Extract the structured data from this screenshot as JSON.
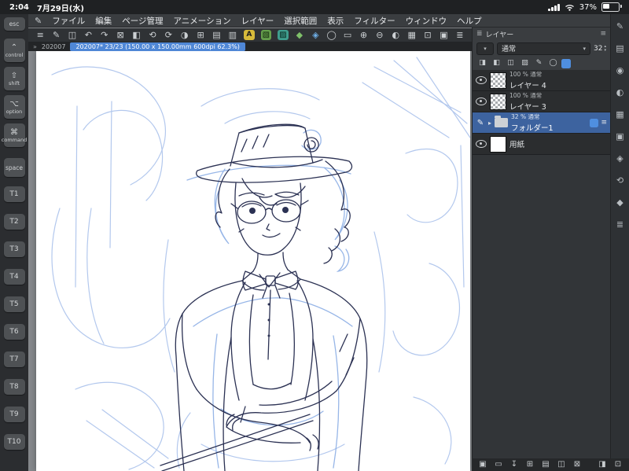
{
  "status_bar": {
    "time": "2:04",
    "date": "7月29日(水)",
    "battery": "37%"
  },
  "menu_bar": {
    "logo": "✎",
    "items": [
      "ファイル",
      "編集",
      "ページ管理",
      "アニメーション",
      "レイヤー",
      "選択範囲",
      "表示",
      "フィルター",
      "ウィンドウ",
      "ヘルプ"
    ]
  },
  "toolbar": {
    "icons": [
      {
        "name": "menu-icon",
        "glyph": "≡"
      },
      {
        "name": "clip-logo-icon",
        "glyph": "✎"
      },
      {
        "name": "save-icon",
        "glyph": "◫"
      },
      {
        "name": "undo-icon",
        "glyph": "↶"
      },
      {
        "name": "redo-icon",
        "glyph": "↷"
      },
      {
        "name": "delete-icon",
        "glyph": "⊠"
      },
      {
        "name": "fill-icon",
        "glyph": "◧"
      },
      {
        "name": "rotate-left-icon",
        "glyph": "⟲"
      },
      {
        "name": "rotate-right-icon",
        "glyph": "⟳"
      },
      {
        "name": "flip-horizontal-icon",
        "glyph": "◑"
      },
      {
        "name": "grid-icon",
        "glyph": "⊞"
      },
      {
        "name": "ruler-icon",
        "glyph": "▤"
      },
      {
        "name": "snap-icon",
        "glyph": "▥"
      },
      {
        "name": "text-tool-icon",
        "glyph": "A",
        "cls": "c-yellow"
      },
      {
        "name": "gradient-icon",
        "glyph": "▧",
        "cls": "c-green"
      },
      {
        "name": "tone-icon",
        "glyph": "▨",
        "cls": "c-teal"
      },
      {
        "name": "material-icon",
        "glyph": "◆",
        "cls": "c-dkgreen"
      },
      {
        "name": "wand-icon",
        "glyph": "◈",
        "cls": "c-blue"
      },
      {
        "name": "lasso-icon",
        "glyph": "◯"
      },
      {
        "name": "marquee-icon",
        "glyph": "▭"
      },
      {
        "name": "select-add-icon",
        "glyph": "⊕"
      },
      {
        "name": "select-remove-icon",
        "glyph": "⊖"
      },
      {
        "name": "invert-select-icon",
        "glyph": "◐"
      },
      {
        "name": "select-border-icon",
        "glyph": "▦"
      },
      {
        "name": "zoom-fit-icon",
        "glyph": "⊡"
      },
      {
        "name": "layer-property-icon",
        "glyph": "▣"
      },
      {
        "name": "panel-settings-icon",
        "glyph": "≣"
      }
    ]
  },
  "tab_bar": {
    "chevron": "»",
    "tab": "202007",
    "info": "202007* 23/23 (150.00 x 150.00mm 600dpi 62.3%)"
  },
  "edge_keyboard": {
    "keys": [
      {
        "name": "esc-key",
        "symbol": "",
        "label": "esc",
        "cls": "k-esc"
      },
      {
        "name": "control-key",
        "symbol": "⌃",
        "label": "control",
        "cls": "k-mod"
      },
      {
        "name": "shift-key",
        "symbol": "⇧",
        "label": "shift",
        "cls": "k-mod"
      },
      {
        "name": "option-key",
        "symbol": "⌥",
        "label": "option",
        "cls": "k-mod"
      },
      {
        "name": "command-key",
        "symbol": "⌘",
        "label": "command",
        "cls": "k-mod"
      },
      {
        "name": "space-key",
        "symbol": "",
        "label": "space",
        "cls": "k-space"
      },
      {
        "name": "t1-key",
        "symbol": "",
        "label": "T1",
        "cls": "k-t"
      },
      {
        "name": "t2-key",
        "symbol": "",
        "label": "T2",
        "cls": "k-t"
      },
      {
        "name": "t3-key",
        "symbol": "",
        "label": "T3",
        "cls": "k-t"
      },
      {
        "name": "t4-key",
        "symbol": "",
        "label": "T4",
        "cls": "k-t"
      },
      {
        "name": "t5-key",
        "symbol": "",
        "label": "T5",
        "cls": "k-t"
      },
      {
        "name": "t6-key",
        "symbol": "",
        "label": "T6",
        "cls": "k-t"
      },
      {
        "name": "t7-key",
        "symbol": "",
        "label": "T7",
        "cls": "k-t"
      },
      {
        "name": "t8-key",
        "symbol": "",
        "label": "T8",
        "cls": "k-t"
      },
      {
        "name": "t9-key",
        "symbol": "",
        "label": "T9",
        "cls": "k-t"
      },
      {
        "name": "t10-key",
        "symbol": "",
        "label": "T10",
        "cls": "k-t"
      }
    ]
  },
  "layers_panel": {
    "title": "レイヤー",
    "title_icon": "≣",
    "panel_menu_icon": "≡",
    "blend_mode": "通常",
    "caret": "▾",
    "opacity": "32",
    "stepper_up": "▴",
    "stepper_down": "▾",
    "tool_icons": [
      {
        "name": "layer-blend-icon",
        "glyph": "◨"
      },
      {
        "name": "clip-mask-icon",
        "glyph": "◧"
      },
      {
        "name": "lock-layer-icon",
        "glyph": "◫"
      },
      {
        "name": "lock-alpha-icon",
        "glyph": "▨"
      },
      {
        "name": "draft-layer-icon",
        "glyph": "✎"
      },
      {
        "name": "layer-mask-icon",
        "glyph": "◯"
      },
      {
        "name": "palette-color-icon",
        "glyph": "",
        "cls": "c-bluebadge"
      }
    ],
    "glyphs": {
      "pencil": "✎",
      "arrow": "▸",
      "row_menu": "≡"
    },
    "layers": [
      {
        "name": "layer-row-4",
        "variant": "v-checker",
        "state": "",
        "info": "100 % 通常",
        "label": "レイヤー 4"
      },
      {
        "name": "layer-row-3",
        "variant": "v-checker",
        "state": "",
        "info": "100 % 通常",
        "label": "レイヤー 3"
      },
      {
        "name": "layer-row-folder-1",
        "variant": "v-folder",
        "state": "selected",
        "info": "32 % 通常",
        "label": "フォルダー1"
      },
      {
        "name": "layer-row-paper",
        "variant": "v-paper",
        "state": "",
        "info": "",
        "label": "用紙"
      }
    ],
    "bottom_icons": [
      {
        "name": "new-layer-icon",
        "glyph": "▣"
      },
      {
        "name": "new-folder-icon",
        "glyph": "▭"
      },
      {
        "name": "transfer-layer-icon",
        "glyph": "↧"
      },
      {
        "name": "merge-layer-icon",
        "glyph": "⊞"
      },
      {
        "name": "layer-settings-icon",
        "glyph": "▤"
      },
      {
        "name": "create-mask-icon",
        "glyph": "◫"
      },
      {
        "name": "delete-layer-icon",
        "glyph": "⊠"
      }
    ]
  },
  "bottom_bar_right_icons": [
    {
      "name": "hide-ui-icon",
      "glyph": "◨"
    },
    {
      "name": "fullscreen-icon",
      "glyph": "⊡"
    }
  ],
  "right_strip": {
    "icons": [
      {
        "name": "palette-tool-icon",
        "glyph": "✎"
      },
      {
        "name": "palette-subtool-icon",
        "glyph": "▤"
      },
      {
        "name": "palette-brush-size-icon",
        "glyph": "◉"
      },
      {
        "name": "palette-color-wheel-icon",
        "glyph": "◐"
      },
      {
        "name": "palette-color-set-icon",
        "glyph": "▦"
      },
      {
        "name": "palette-layer-icon",
        "glyph": "▣"
      },
      {
        "name": "palette-navigator-icon",
        "glyph": "◈"
      },
      {
        "name": "palette-history-icon",
        "glyph": "⟲"
      },
      {
        "name": "palette-material-icon",
        "glyph": "◆"
      },
      {
        "name": "palette-info-icon",
        "glyph": "≣"
      }
    ]
  },
  "canvas": {
    "colors": {
      "page": "#ffffff",
      "pencil_blue": "#9ab6e8",
      "pencil_blue_strong": "#7ea4e2",
      "ink": "#2b3153"
    }
  }
}
